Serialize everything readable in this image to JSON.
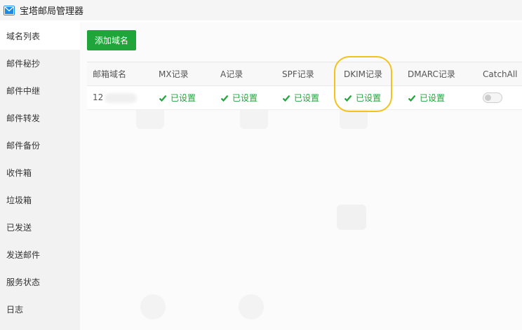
{
  "app": {
    "title": "宝塔邮局管理器",
    "icon": "mail-icon"
  },
  "sidebar": {
    "items": [
      {
        "label": "域名列表",
        "active": true
      },
      {
        "label": "邮件秘抄"
      },
      {
        "label": "邮件中继"
      },
      {
        "label": "邮件转发"
      },
      {
        "label": "邮件备份"
      },
      {
        "label": "收件箱"
      },
      {
        "label": "垃圾箱"
      },
      {
        "label": "已发送"
      },
      {
        "label": "发送邮件"
      },
      {
        "label": "服务状态"
      },
      {
        "label": "日志"
      }
    ]
  },
  "toolbar": {
    "add_domain_label": "添加域名"
  },
  "table": {
    "headers": [
      "邮箱域名",
      "MX记录",
      "A记录",
      "SPF记录",
      "DKIM记录",
      "DMARC记录",
      "CatchAll"
    ],
    "rows": [
      {
        "domain": "12",
        "mx": "已设置",
        "a": "已设置",
        "spf": "已设置",
        "dkim": "已设置",
        "dmarc": "已设置",
        "catchall": false
      }
    ]
  },
  "colors": {
    "accent": "#20a53a",
    "highlight": "#f3c21b"
  }
}
